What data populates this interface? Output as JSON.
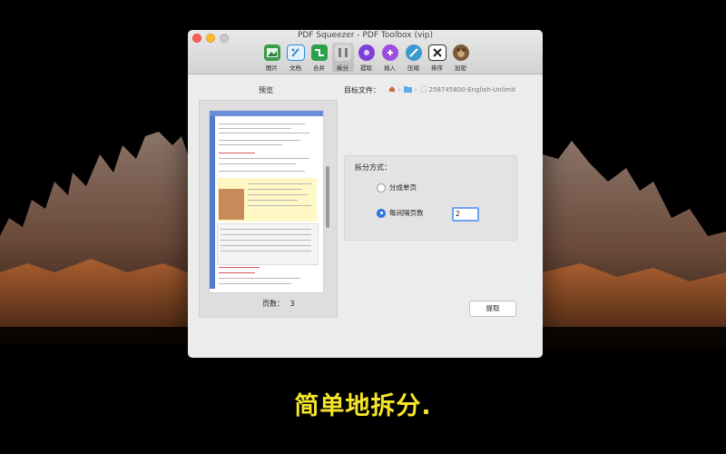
{
  "window": {
    "title": "PDF Squeezer - PDF Toolbox (vip)"
  },
  "toolbar": {
    "items": [
      {
        "label": "图片",
        "icon": "image-icon",
        "color": "#3a9b4b"
      },
      {
        "label": "文档",
        "icon": "document-icon",
        "color": "#2e8bd6"
      },
      {
        "label": "合并",
        "icon": "merge-icon",
        "color": "#2aa14a"
      },
      {
        "label": "拆分",
        "icon": "split-icon",
        "color": "#8a8a8a"
      },
      {
        "label": "提取",
        "icon": "extract-icon",
        "color": "#7d3fd6"
      },
      {
        "label": "插入",
        "icon": "insert-icon",
        "color": "#9a4fe0"
      },
      {
        "label": "压缩",
        "icon": "compress-icon",
        "color": "#3d9ad0"
      },
      {
        "label": "排序",
        "icon": "sort-icon",
        "color": "#222222"
      },
      {
        "label": "加密",
        "icon": "encrypt-icon",
        "color": "#7a5a3a"
      }
    ],
    "active_index": 3
  },
  "preview": {
    "title": "预览",
    "pages_label": "页数：",
    "pages_value": "3"
  },
  "target": {
    "label": "目标文件：",
    "path_file": "258745800-English-Unlimit"
  },
  "split": {
    "title": "拆分方式：",
    "option_single": "分成单页",
    "option_every": "每间隔页数",
    "every_value": "2",
    "selected": "every"
  },
  "actions": {
    "extract_label": "提取"
  },
  "caption": "简单地拆分."
}
